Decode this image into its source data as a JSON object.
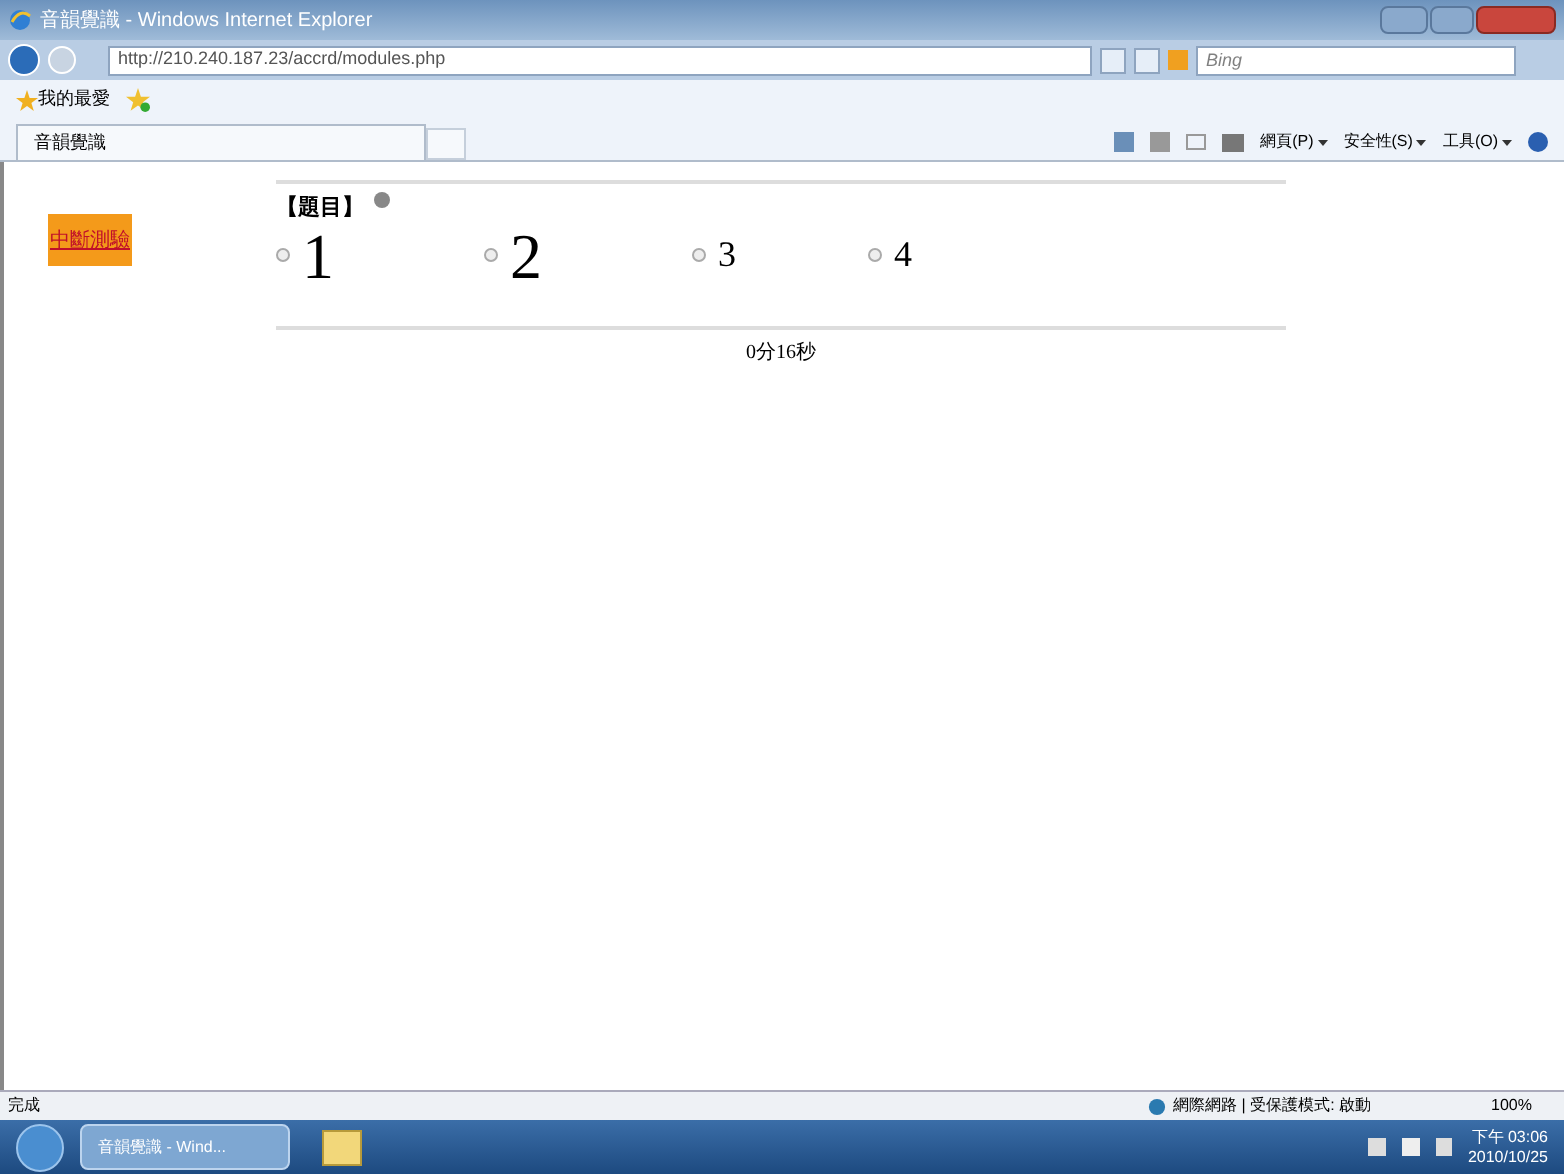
{
  "window": {
    "title": "音韻覺識 - Windows Internet Explorer"
  },
  "address_bar": {
    "url": "http://210.240.187.23/accrd/modules.php"
  },
  "search": {
    "placeholder": "Bing"
  },
  "favorites_bar": {
    "label": "我的最愛"
  },
  "tabs": [
    {
      "label": "音韻覺識",
      "selected": true
    }
  ],
  "command_bar": [
    "網頁(P)",
    "安全性(S)",
    "工具(O)"
  ],
  "page": {
    "stop_button": "中斷測驗",
    "question_label": "【題目】",
    "options": [
      {
        "label": "1",
        "kind": "large",
        "selected": false
      },
      {
        "label": "2",
        "kind": "large",
        "selected": false
      },
      {
        "label": "3",
        "kind": "small",
        "selected": false
      },
      {
        "label": "4",
        "kind": "small",
        "selected": false
      }
    ],
    "timer": "0分16秒"
  },
  "status_bar": {
    "text": "完成",
    "zone": "網際網路 | 受保護模式: 啟動",
    "zoom": "100%"
  },
  "taskbar": {
    "items": [
      {
        "label": "音韻覺識 - Wind...",
        "selected": true
      }
    ],
    "time": "下午 03:06",
    "date": "2010/10/25"
  }
}
